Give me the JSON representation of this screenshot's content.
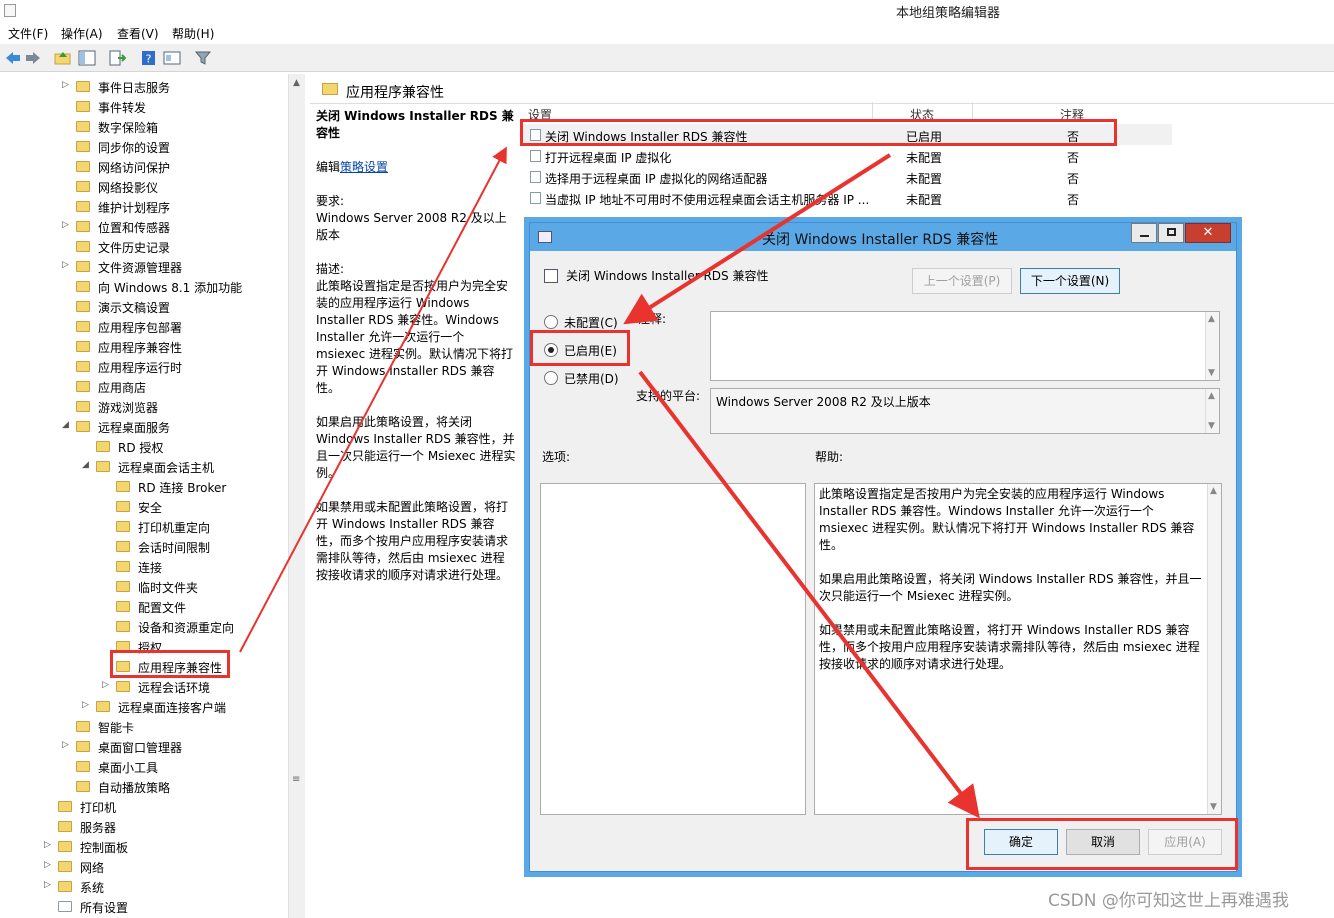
{
  "window": {
    "title": "本地组策略编辑器"
  },
  "menu": [
    "文件(F)",
    "操作(A)",
    "查看(V)",
    "帮助(H)"
  ],
  "toolbar_icons": [
    "back-icon",
    "forward-icon",
    "up-folder-icon",
    "show-hide-tree-icon",
    "export-icon",
    "help-icon",
    "properties-icon",
    "filter-icon"
  ],
  "tree": [
    {
      "label": "事件日志服务",
      "level": 3,
      "arrow": "▷"
    },
    {
      "label": "事件转发",
      "level": 3,
      "arrow": ""
    },
    {
      "label": "数字保险箱",
      "level": 3,
      "arrow": ""
    },
    {
      "label": "同步你的设置",
      "level": 3,
      "arrow": ""
    },
    {
      "label": "网络访问保护",
      "level": 3,
      "arrow": ""
    },
    {
      "label": "网络投影仪",
      "level": 3,
      "arrow": ""
    },
    {
      "label": "维护计划程序",
      "level": 3,
      "arrow": ""
    },
    {
      "label": "位置和传感器",
      "level": 3,
      "arrow": "▷"
    },
    {
      "label": "文件历史记录",
      "level": 3,
      "arrow": ""
    },
    {
      "label": "文件资源管理器",
      "level": 3,
      "arrow": "▷"
    },
    {
      "label": "向 Windows 8.1 添加功能",
      "level": 3,
      "arrow": ""
    },
    {
      "label": "演示文稿设置",
      "level": 3,
      "arrow": ""
    },
    {
      "label": "应用程序包部署",
      "level": 3,
      "arrow": ""
    },
    {
      "label": "应用程序兼容性",
      "level": 3,
      "arrow": ""
    },
    {
      "label": "应用程序运行时",
      "level": 3,
      "arrow": ""
    },
    {
      "label": "应用商店",
      "level": 3,
      "arrow": ""
    },
    {
      "label": "游戏浏览器",
      "level": 3,
      "arrow": ""
    },
    {
      "label": "远程桌面服务",
      "level": 3,
      "arrow": "◢"
    },
    {
      "label": "RD 授权",
      "level": 4,
      "arrow": ""
    },
    {
      "label": "远程桌面会话主机",
      "level": 4,
      "arrow": "◢"
    },
    {
      "label": "RD 连接 Broker",
      "level": 5,
      "arrow": ""
    },
    {
      "label": "安全",
      "level": 5,
      "arrow": ""
    },
    {
      "label": "打印机重定向",
      "level": 5,
      "arrow": ""
    },
    {
      "label": "会话时间限制",
      "level": 5,
      "arrow": ""
    },
    {
      "label": "连接",
      "level": 5,
      "arrow": ""
    },
    {
      "label": "临时文件夹",
      "level": 5,
      "arrow": ""
    },
    {
      "label": "配置文件",
      "level": 5,
      "arrow": ""
    },
    {
      "label": "设备和资源重定向",
      "level": 5,
      "arrow": ""
    },
    {
      "label": "授权",
      "level": 5,
      "arrow": ""
    },
    {
      "label": "应用程序兼容性",
      "level": 5,
      "arrow": "",
      "selected": true
    },
    {
      "label": "远程会话环境",
      "level": 5,
      "arrow": "▷"
    },
    {
      "label": "远程桌面连接客户端",
      "level": 4,
      "arrow": "▷"
    },
    {
      "label": "智能卡",
      "level": 3,
      "arrow": ""
    },
    {
      "label": "桌面窗口管理器",
      "level": 3,
      "arrow": "▷"
    },
    {
      "label": "桌面小工具",
      "level": 3,
      "arrow": ""
    },
    {
      "label": "自动播放策略",
      "level": 3,
      "arrow": ""
    },
    {
      "label": "打印机",
      "level": 2,
      "arrow": ""
    },
    {
      "label": "服务器",
      "level": 2,
      "arrow": ""
    },
    {
      "label": "控制面板",
      "level": 2,
      "arrow": "▷"
    },
    {
      "label": "网络",
      "level": 2,
      "arrow": "▷"
    },
    {
      "label": "系统",
      "level": 2,
      "arrow": "▷"
    },
    {
      "label": "所有设置",
      "level": 2,
      "arrow": "",
      "file": true
    }
  ],
  "right": {
    "title": "应用程序兼容性",
    "desc": {
      "heading": "关闭 Windows Installer RDS 兼容性",
      "edit_prefix": "编辑",
      "edit_link": "策略设置",
      "req_label": "要求:",
      "req_value": "Windows Server 2008 R2 及以上版本",
      "desc_label": "描述:",
      "p1": "此策略设置指定是否按用户为完全安装的应用程序运行 Windows Installer RDS 兼容性。Windows Installer 允许一次运行一个 msiexec 进程实例。默认情况下将打开 Windows Installer RDS 兼容性。",
      "p2": "如果启用此策略设置，将关闭 Windows Installer RDS 兼容性，并且一次只能运行一个 Msiexec 进程实例。",
      "p3": "如果禁用或未配置此策略设置，将打开 Windows Installer RDS 兼容性，而多个按用户应用程序安装请求需排队等待，然后由 msiexec 进程按接收请求的顺序对请求进行处理。"
    },
    "columns": {
      "name": "设置",
      "state": "状态",
      "comment": "注释"
    },
    "rows": [
      {
        "name": "关闭 Windows Installer RDS 兼容性",
        "state": "已启用",
        "comment": "否"
      },
      {
        "name": "打开远程桌面 IP 虚拟化",
        "state": "未配置",
        "comment": "否"
      },
      {
        "name": "选择用于远程桌面 IP 虚拟化的网络适配器",
        "state": "未配置",
        "comment": "否"
      },
      {
        "name": "当虚拟 IP 地址不可用时不使用远程桌面会话主机服务器 IP ...",
        "state": "未配置",
        "comment": "否"
      }
    ]
  },
  "dialog": {
    "title": "关闭 Windows Installer RDS 兼容性",
    "setting_name": "关闭 Windows Installer RDS 兼容性",
    "prev_btn": "上一个设置(P)",
    "next_btn": "下一个设置(N)",
    "radio_not_configured": "未配置(C)",
    "radio_enabled": "已启用(E)",
    "radio_disabled": "已禁用(D)",
    "selected_option": "已启用(E)",
    "comment_label": "注释:",
    "platform_label": "支持的平台:",
    "platform_value": "Windows Server 2008 R2 及以上版本",
    "options_label": "选项:",
    "help_label": "帮助:",
    "help_p1": "此策略设置指定是否按用户为完全安装的应用程序运行 Windows Installer RDS 兼容性。Windows Installer 允许一次运行一个 msiexec 进程实例。默认情况下将打开 Windows Installer RDS 兼容性。",
    "help_p2": "如果启用此策略设置，将关闭 Windows Installer RDS 兼容性，并且一次只能运行一个 Msiexec 进程实例。",
    "help_p3": "如果禁用或未配置此策略设置，将打开 Windows Installer RDS 兼容性，而多个按用户应用程序安装请求需排队等待，然后由 msiexec 进程按接收请求的顺序对请求进行处理。",
    "ok_btn": "确定",
    "cancel_btn": "取消",
    "apply_btn": "应用(A)"
  },
  "watermark": "CSDN @你可知这世上再难遇我",
  "colors": {
    "annotation_red": "#e8332f",
    "dialog_border": "#5aa9e6",
    "link": "#0645ad"
  }
}
